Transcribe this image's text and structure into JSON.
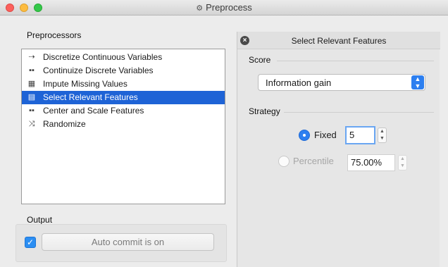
{
  "window": {
    "title": "Preprocess",
    "title_icon": "gears-icon"
  },
  "left_panel": {
    "preprocessors_title": "Preprocessors",
    "items": [
      {
        "label": "Discretize Continuous Variables",
        "icon": "discretize-icon"
      },
      {
        "label": "Continuize Discrete Variables",
        "icon": "continuize-icon"
      },
      {
        "label": "Impute Missing Values",
        "icon": "impute-icon"
      },
      {
        "label": "Select Relevant Features",
        "icon": "select-features-icon",
        "selected": true
      },
      {
        "label": "Center and Scale Features",
        "icon": "center-scale-icon"
      },
      {
        "label": "Randomize",
        "icon": "randomize-icon"
      }
    ],
    "output_title": "Output",
    "auto_commit_checked": true,
    "auto_commit_label": "Auto commit is on"
  },
  "right_panel": {
    "header_title": "Select Relevant Features",
    "score_title": "Score",
    "score_value": "Information gain",
    "strategy_title": "Strategy",
    "fixed_label": "Fixed",
    "fixed_value": "5",
    "percentile_label": "Percentile",
    "percentile_value": "75.00%",
    "selected_strategy": "Fixed"
  },
  "colors": {
    "accent": "#2d7ff0",
    "selection": "#1e63d6"
  }
}
